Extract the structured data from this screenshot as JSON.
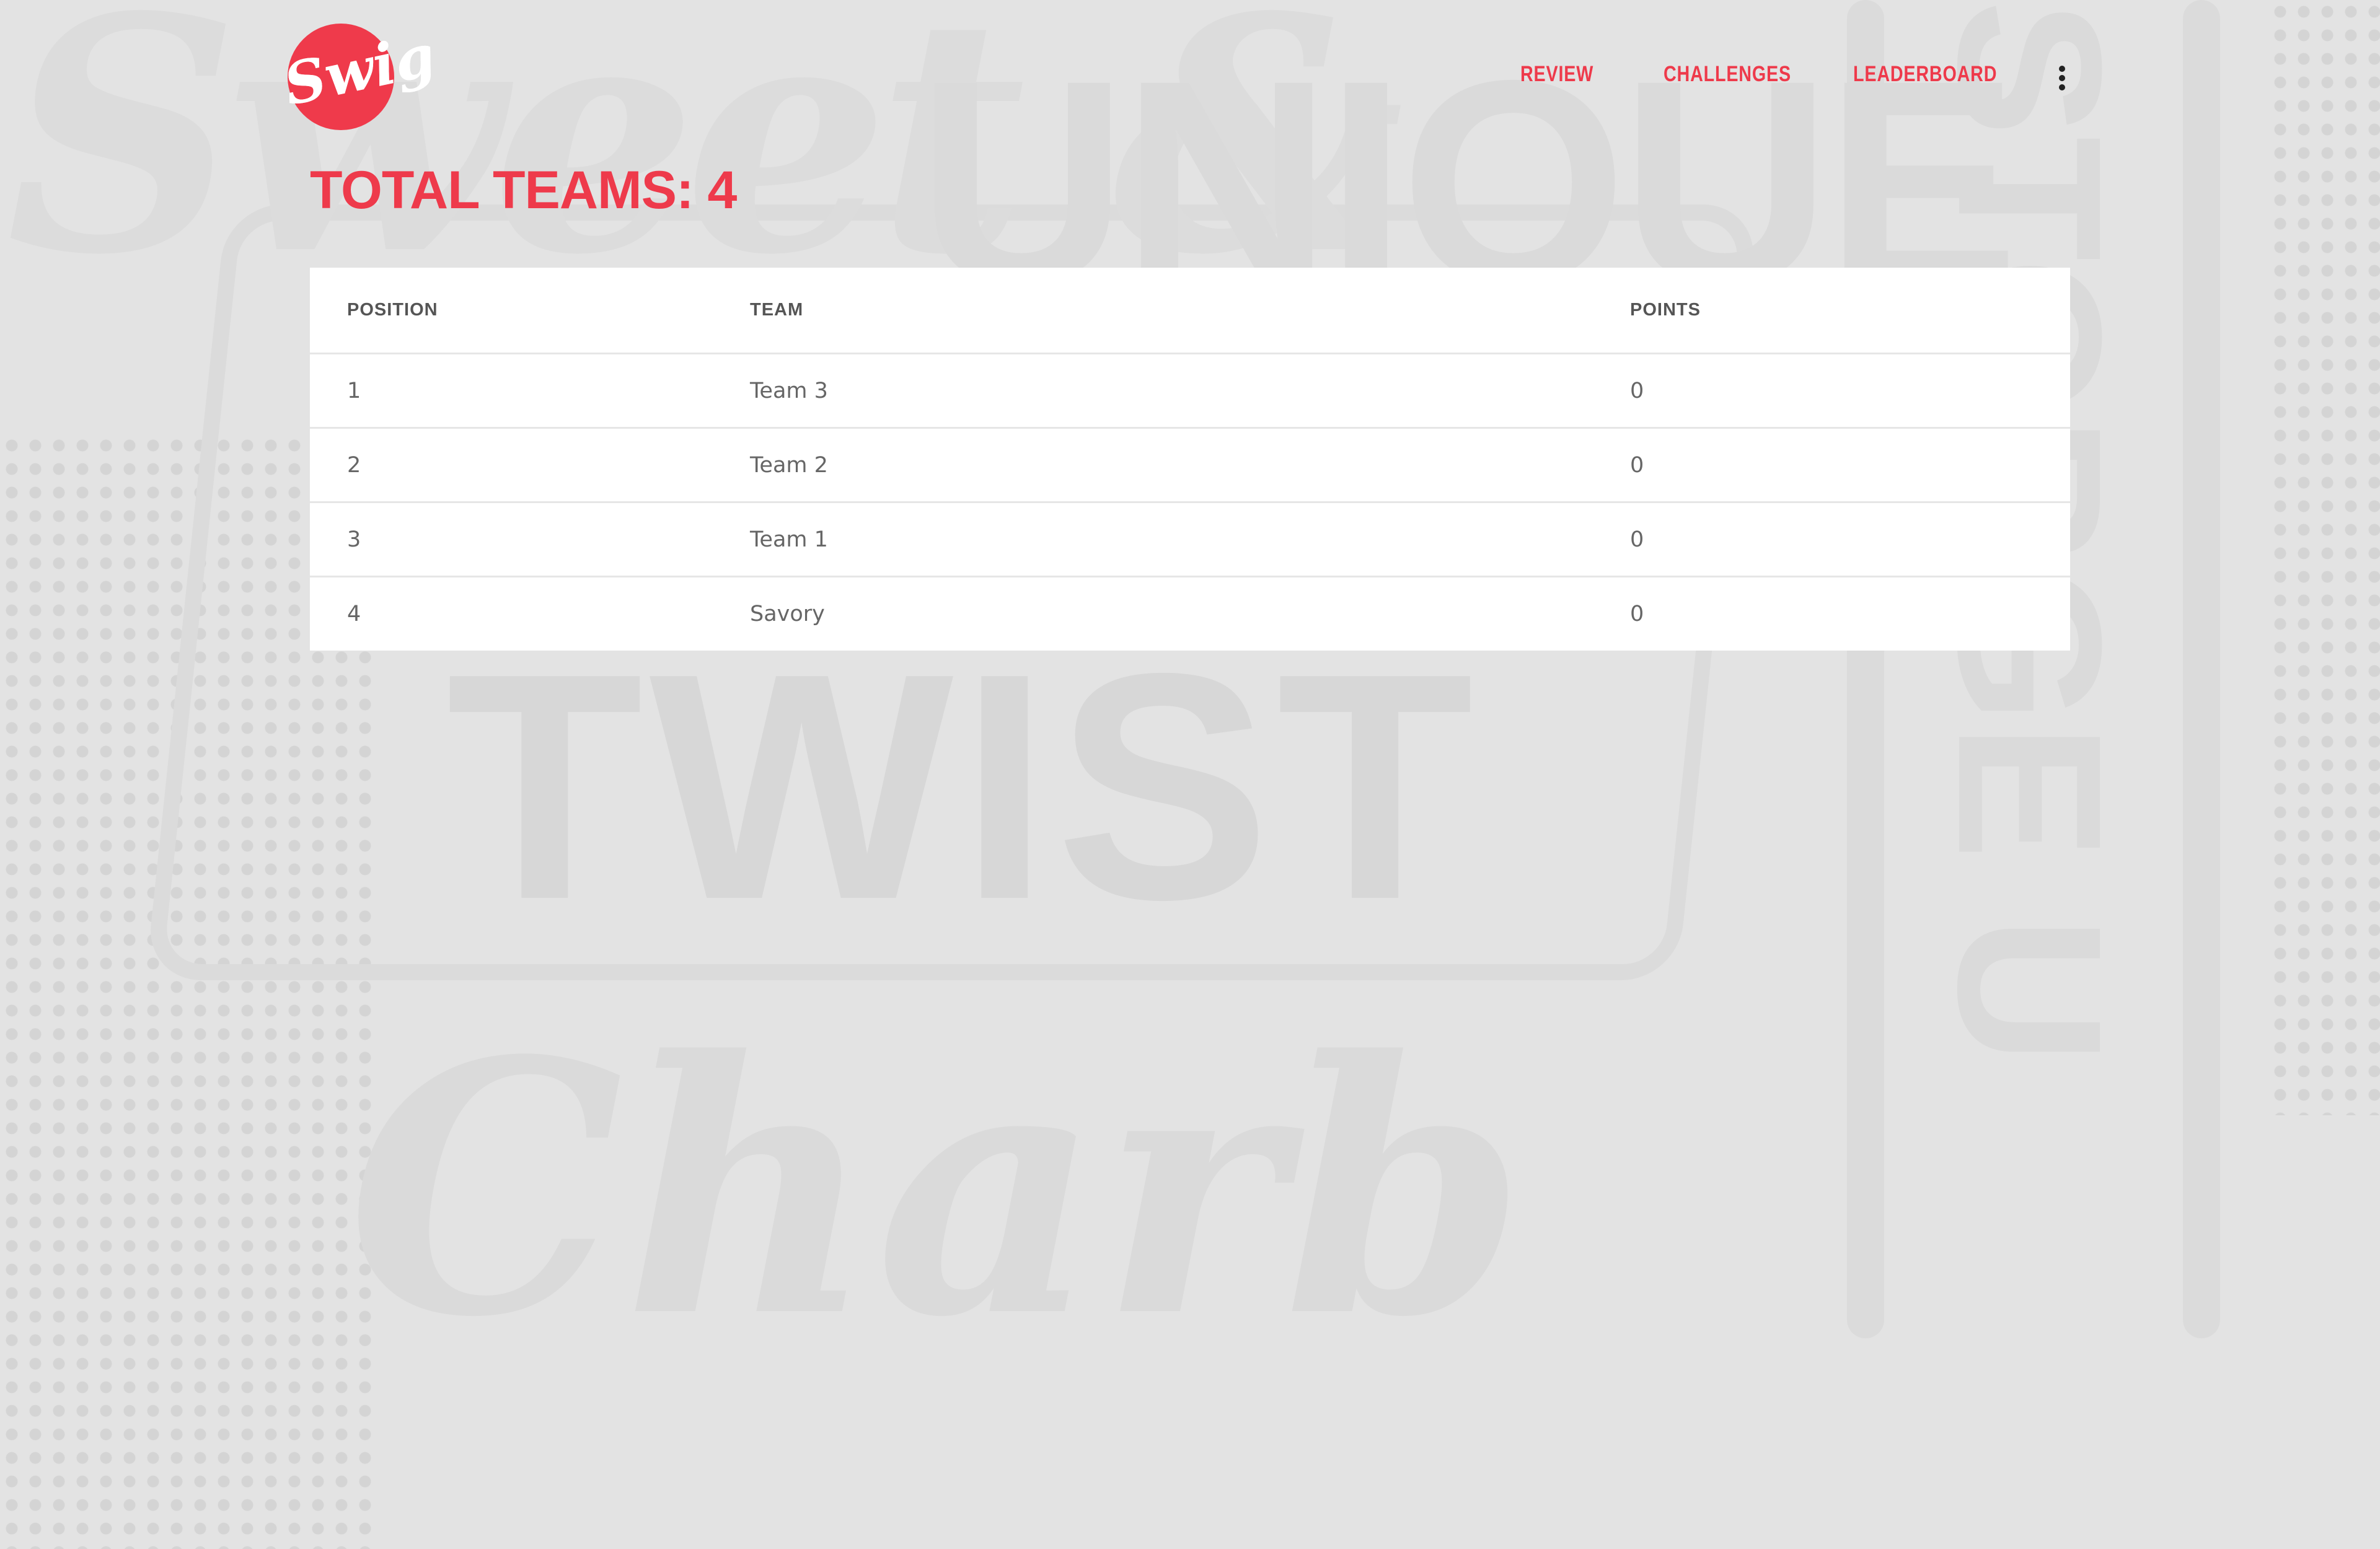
{
  "brand": {
    "logo_text": "Swig",
    "accent": "#ee3a4b"
  },
  "background": {
    "words": [
      "Sweet &",
      "UNIQUE",
      "TWIST",
      "Charb",
      "STORGE U"
    ]
  },
  "nav": {
    "items": [
      {
        "label": "REVIEW"
      },
      {
        "label": "CHALLENGES"
      },
      {
        "label": "LEADERBOARD"
      }
    ],
    "menu_icon": "kebab-menu-icon"
  },
  "page": {
    "title": "TOTAL TEAMS: 4"
  },
  "table": {
    "headers": [
      "POSITION",
      "TEAM",
      "POINTS"
    ],
    "rows": [
      {
        "position": "1",
        "team": "Team 3",
        "points": "0"
      },
      {
        "position": "2",
        "team": "Team 2",
        "points": "0"
      },
      {
        "position": "3",
        "team": "Team 1",
        "points": "0"
      },
      {
        "position": "4",
        "team": "Savory",
        "points": "0"
      }
    ]
  }
}
